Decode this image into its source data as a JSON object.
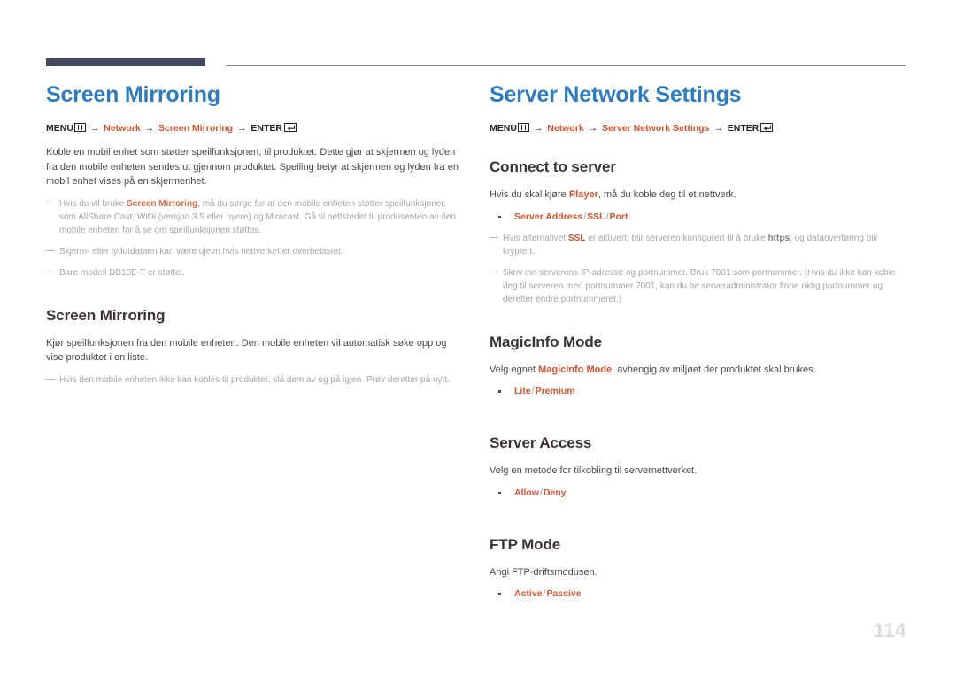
{
  "page": {
    "number": "114",
    "accent_blue": "#2e7cbe",
    "accent_orange": "#d8512c",
    "rule_dark": "#464a5e"
  },
  "left_column": {
    "title": "Screen Mirroring",
    "menu_path": {
      "menu_label": "MENU",
      "arrow": "→",
      "step1": "Network",
      "step2": "Screen Mirroring",
      "enter_label": "ENTER"
    },
    "intro": {
      "text": "Koble en mobil enhet som støtter speilfunksjonen, til produktet. Dette gjør at skjermen og lyden fra den mobile enheten sendes ut gjennom produktet. Speiling betyr at skjermen og lyden fra en mobil enhet vises på en skjermenhet."
    },
    "notes": [
      {
        "pre": "Hvis du vil bruke ",
        "hl": "Screen Mirroring",
        "post": ", må du sørge for at den mobile enheten støtter speilfunksjoner, som AllShare Cast, WiDi (versjon 3.5 eller nyere) og Miracast. Gå til nettstedet til produsenten av den mobile enheten for å se om speilfunksjonen støttes."
      },
      {
        "pre": "Skjerm- eller lydutdataen kan være ujevn hvis nettverket er overbelastet.",
        "hl": "",
        "post": ""
      },
      {
        "pre": "Bare modell DB10E-T er støttet.",
        "hl": "",
        "post": ""
      }
    ],
    "section": {
      "heading": "Screen Mirroring",
      "body": "Kjør speilfunksjonen fra den mobile enheten. Den mobile enheten vil automatisk søke opp og vise produktet i en liste.",
      "note": "Hvis den mobile enheten ikke kan kobles til produktet, slå dem av og på igjen. Prøv deretter på nytt."
    }
  },
  "right_column": {
    "title": "Server Network Settings",
    "menu_path": {
      "menu_label": "MENU",
      "arrow": "→",
      "step1": "Network",
      "step2": "Server Network Settings",
      "enter_label": "ENTER"
    },
    "sections": [
      {
        "heading": "Connect to server",
        "body_pre": "Hvis du skal kjøre ",
        "body_hl": "Player",
        "body_post": ", må du koble deg til et nettverk.",
        "option": "Server Address / SSL / Port",
        "option_parts": [
          "Server Address",
          "SSL",
          "Port"
        ],
        "note1_pre": "Hvis alternativet ",
        "note1_hl": "SSL",
        "note1_mid": " er aktivert, blir serveren konfigurert til å bruke ",
        "note1_b": "https",
        "note1_post": ", og dataoverføring blir kryptert.",
        "note2": "Skriv inn serverens IP-adresse og portnummer. Bruk 7001 som portnummer. (Hvis du ikke kan koble deg til serveren med portnummer 7001, kan du be serveradministrator finne riktig portnummer og deretter endre portnummeret.)"
      },
      {
        "heading": "MagicInfo Mode",
        "body_pre": "Velg egnet ",
        "body_hl": "MagicInfo Mode",
        "body_post": ", avhengig av miljøet der produktet skal brukes.",
        "option_parts": [
          "Lite",
          "Premium"
        ]
      },
      {
        "heading": "Server Access",
        "body_pre": "Velg en metode for tilkobling til servernettverket.",
        "body_hl": "",
        "body_post": "",
        "option_parts": [
          "Allow",
          "Deny"
        ]
      },
      {
        "heading": "FTP Mode",
        "body_pre": "Angi FTP-driftsmodusen.",
        "body_hl": "",
        "body_post": "",
        "option_parts": [
          "Active",
          "Passive"
        ]
      }
    ]
  }
}
